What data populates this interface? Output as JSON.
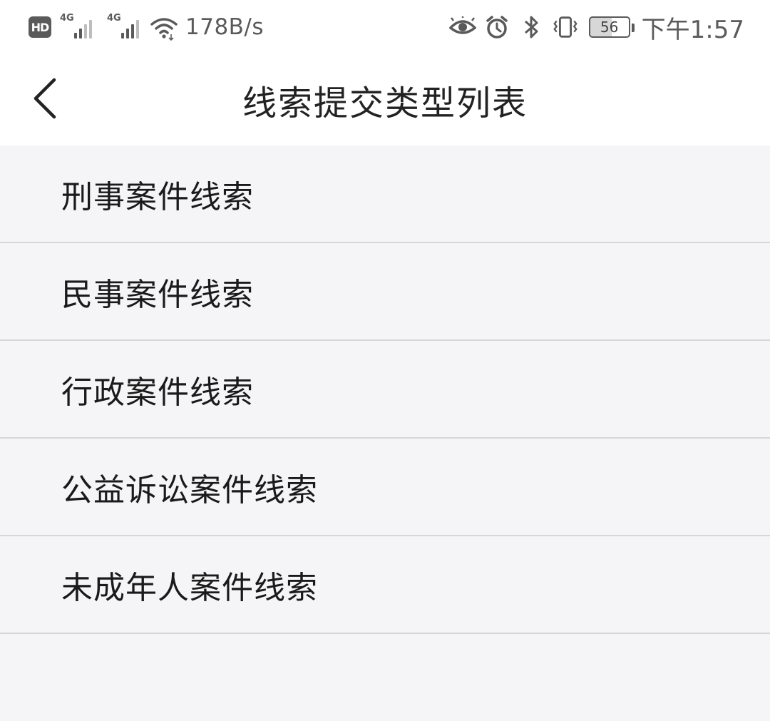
{
  "status_bar": {
    "hd_badge": "HD",
    "signal_1_label": "4G",
    "signal_2_label": "4G",
    "net_speed": "178B/s",
    "battery_level": "56",
    "time": "下午1:57",
    "icons": [
      "eye-comfort-icon",
      "alarm-icon",
      "bluetooth-icon",
      "vibrate-icon"
    ]
  },
  "header": {
    "title": "线索提交类型列表",
    "back_icon": "chevron-left-icon"
  },
  "list": {
    "items": [
      {
        "label": "刑事案件线索"
      },
      {
        "label": "民事案件线索"
      },
      {
        "label": "行政案件线索"
      },
      {
        "label": "公益诉讼案件线索"
      },
      {
        "label": "未成年人案件线索"
      }
    ]
  },
  "colors": {
    "background": "#f5f5f7",
    "header_background": "#ffffff",
    "divider": "#d6d6d6",
    "status_text": "#5a5a5a",
    "text": "#1a1a1a"
  }
}
